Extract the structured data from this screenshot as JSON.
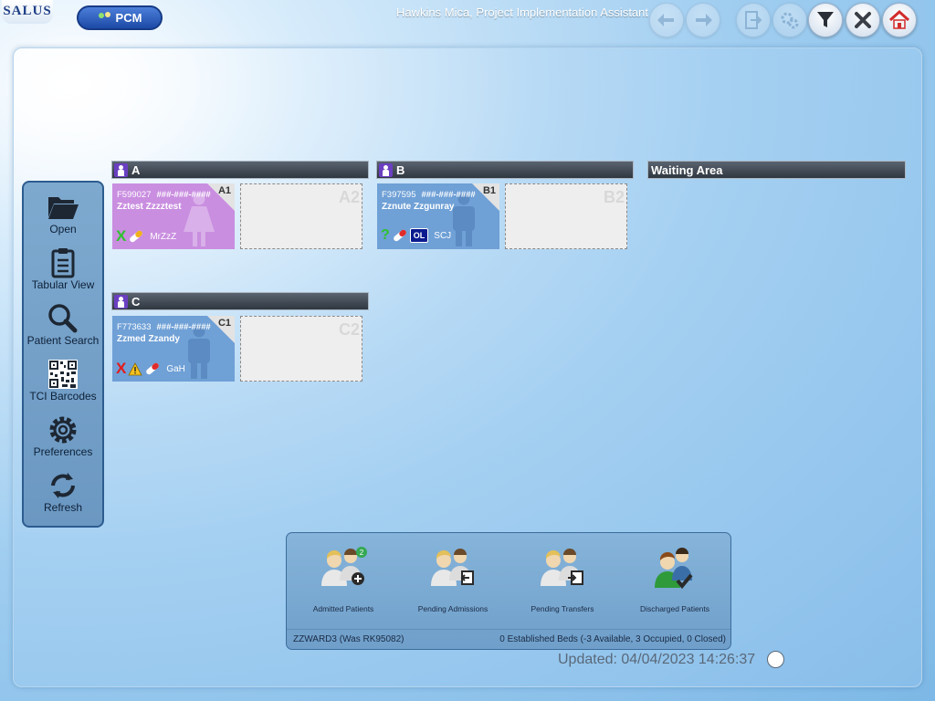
{
  "app": {
    "logo_text": "SALUS",
    "module_button": "PCM",
    "user_title": "Hawkins Mica, Project Implementation Assistant"
  },
  "toolbar": {
    "buttons": [
      {
        "name": "back-arrow",
        "enabled": false
      },
      {
        "name": "forward-arrow",
        "enabled": false
      },
      {
        "name": "exit-door",
        "enabled": false
      },
      {
        "name": "settings-gears",
        "enabled": false
      },
      {
        "name": "filter",
        "enabled": true
      },
      {
        "name": "close",
        "enabled": true
      },
      {
        "name": "home",
        "enabled": true
      }
    ]
  },
  "sidebar": {
    "items": [
      {
        "label": "Open",
        "icon": "folder-open-icon"
      },
      {
        "label": "Tabular View",
        "icon": "clipboard-icon"
      },
      {
        "label": "Patient Search",
        "icon": "magnifier-icon"
      },
      {
        "label": "TCI Barcodes",
        "icon": "qr-code-icon"
      },
      {
        "label": "Preferences",
        "icon": "gear-icon"
      },
      {
        "label": "Refresh",
        "icon": "refresh-icon"
      }
    ]
  },
  "bays": [
    {
      "label": "A"
    },
    {
      "label": "B"
    },
    {
      "label": "Waiting Area"
    },
    {
      "label": "C"
    }
  ],
  "beds": {
    "A1": {
      "code": "A1",
      "id": "F599027",
      "nhs": "###-###-####",
      "name": "Zztest Zzzztest",
      "consultant": "MrZzZ",
      "status_mark": "X",
      "status_color": "#2fc12f",
      "card_color": "#c98ee0",
      "sex": "female"
    },
    "A2": {
      "code": "A2"
    },
    "B1": {
      "code": "B1",
      "id": "F397595",
      "nhs": "###-###-####",
      "name": "Zznute Zzgunray",
      "consultant": "SCJ",
      "status_mark": "?",
      "status_color": "#2fc12f",
      "badge": "OL",
      "card_color": "#6fa0d6",
      "sex": "male"
    },
    "B2": {
      "code": "B2"
    },
    "C1": {
      "code": "C1",
      "id": "F773633",
      "nhs": "###-###-####",
      "name": "Zzmed Zzandy",
      "consultant": "GaH",
      "status_mark": "X",
      "status_color": "#e41a1a",
      "card_color": "#6fa0d6",
      "sex": "male"
    },
    "C2": {
      "code": "C2"
    }
  },
  "dock": {
    "items": [
      {
        "label": "Admitted Patients",
        "badge": "2"
      },
      {
        "label": "Pending Admissions"
      },
      {
        "label": "Pending Transfers"
      },
      {
        "label": "Discharged Patients"
      }
    ],
    "ward": "ZZWARD3 (Was RK95082)",
    "beds_summary": "0 Established Beds (-3 Available, 3 Occupied, 0 Closed)"
  },
  "updated": "Updated: 04/04/2023 14:26:37",
  "colors": {
    "pcm_button": "#2a5cbf",
    "bay_header": "#3a434d",
    "bay_icon": "#6a3fc1",
    "sidebar": "#7aa6cd"
  }
}
